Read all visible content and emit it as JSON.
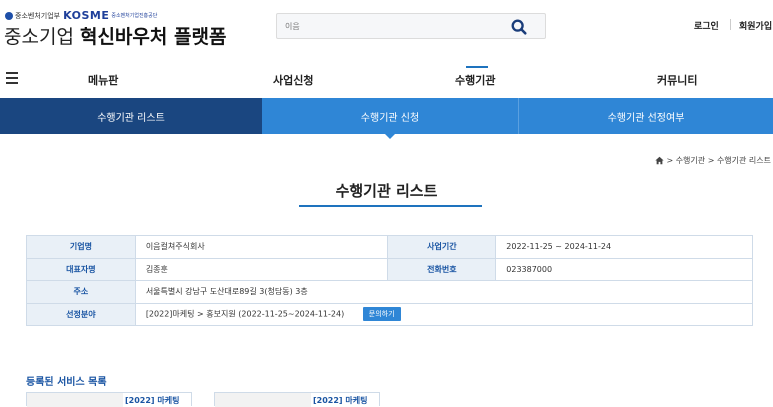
{
  "header": {
    "agency_name": "중소벤처기업부",
    "kosme_brand": "KOSME",
    "kosme_sub": "중소벤처기업진흥공단",
    "site_title_plain": "중소기업 ",
    "site_title_bold": "혁신바우처 플랫폼",
    "search_placeholder": "이음",
    "login_label": "로그인",
    "join_label": "회원가입"
  },
  "nav": {
    "items": [
      {
        "label": "메뉴판"
      },
      {
        "label": "사업신청"
      },
      {
        "label": "수행기관",
        "active": true
      },
      {
        "label": "커뮤니티"
      }
    ]
  },
  "subnav": {
    "items": [
      {
        "label": "수행기관 리스트"
      },
      {
        "label": "수행기관 신청",
        "active": true
      },
      {
        "label": "수행기관 선정여부"
      }
    ]
  },
  "breadcrumb": {
    "sep1": ">",
    "level1": "수행기관",
    "sep2": ">",
    "level2": "수행기관 리스트"
  },
  "page_title": "수행기관 리스트",
  "info": {
    "company_label": "기업명",
    "company_value": "이음컬쳐주식회사",
    "period_label": "사업기간",
    "period_value": "2022-11-25 ~ 2024-11-24",
    "ceo_label": "대표자명",
    "ceo_value": "김종훈",
    "phone_label": "전화번호",
    "phone_value": "023387000",
    "address_label": "주소",
    "address_value": "서울특별시 강남구 도산대로89길 3(청담동) 3층",
    "field_label": "선정분야",
    "field_value": "[2022]마케팅 > 홍보지원 (2022-11-25~2024-11-24)",
    "inquiry_button": "문의하기"
  },
  "services": {
    "title": "등록된 서비스 목록",
    "cards": [
      {
        "label": "[2022] 마케팅"
      },
      {
        "label": "[2022] 마케팅"
      }
    ]
  },
  "colors": {
    "primary_dark": "#1a4680",
    "primary": "#2f86d6",
    "accent_text": "#1a55a3"
  }
}
